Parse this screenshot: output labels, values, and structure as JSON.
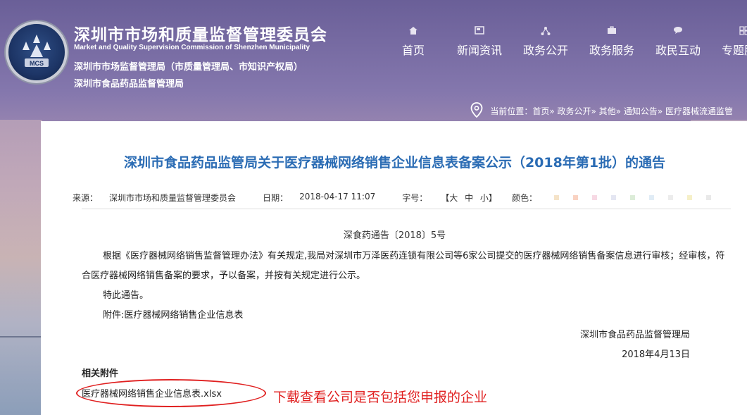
{
  "header": {
    "logo_text": "MCS",
    "org_title": "深圳市市场和质量监督管理委员会",
    "org_en": "Market and Quality Supervision Commission of Shenzhen Municipality",
    "org_sub1": "深圳市市场监督管理局（市质量管理局、市知识产权局）",
    "org_sub2": "深圳市食品药品监督管理局"
  },
  "nav": {
    "items": [
      {
        "label": "首页",
        "icon": "home-icon"
      },
      {
        "label": "新闻资讯",
        "icon": "news-icon"
      },
      {
        "label": "政务公开",
        "icon": "network-icon"
      },
      {
        "label": "政务服务",
        "icon": "briefcase-icon"
      },
      {
        "label": "政民互动",
        "icon": "chat-icon"
      },
      {
        "label": "专题服务",
        "icon": "grid-icon"
      }
    ]
  },
  "breadcrumb": {
    "text": "当前位置：首页» 政务公开» 其他» 通知公告» 医疗器械流通监管"
  },
  "article": {
    "title": "深圳市食品药品监管局关于医疗器械网络销售企业信息表备案公示（2018年第1批）的通告",
    "source_label": "来源：",
    "source_value": "深圳市市场和质量监督管理委员会",
    "date_label": "日期：",
    "date_value": "2018-04-17 11:07",
    "font_label": "字号：",
    "font_sizes": {
      "open": "【大",
      "mid": "中",
      "close": "小】"
    },
    "color_label": "颜色：",
    "swatch_colors": [
      "#f5e3c8",
      "#f9d2c2",
      "#f7d9e4",
      "#e4e6f2",
      "#dcecd8",
      "#e0ecf6",
      "#ececec",
      "#f6f0c8",
      "#e9e9e9"
    ],
    "doc_no": "深食药通告〔2018〕5号",
    "paragraphs": [
      "根据《医疗器械网络销售监督管理办法》有关规定,我局对深圳市万泽医药连锁有限公司等6家公司提交的医疗器械网络销售备案信息进行审核；经审核，符合医疗器械网络销售备案的要求，予以备案，并按有关规定进行公示。",
      "特此通告。",
      "附件:医疗器械网络销售企业信息表"
    ],
    "sign_org": "深圳市食品药品监督管理局",
    "sign_date": "2018年4月13日",
    "attachments_heading": "相关附件",
    "attachment_file": "医疗器械网络销售企业信息表.xlsx",
    "annotation_note": "下载查看公司是否包括您申报的企业"
  },
  "colors": {
    "title_blue": "#2b6cb4",
    "annotation_red": "#e02020"
  }
}
